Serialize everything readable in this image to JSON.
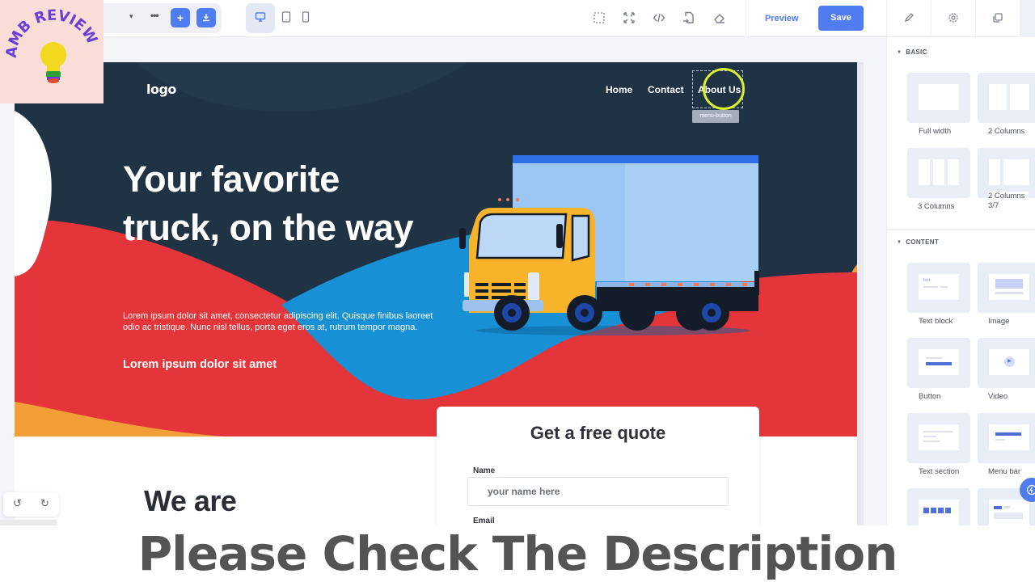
{
  "toolbar": {
    "caret_glyph": "▾",
    "more_glyph": "•••",
    "add_glyph": "+",
    "devices": [
      "desktop",
      "tablet",
      "mobile"
    ],
    "active_device": "desktop",
    "tools": [
      "select-outline-icon",
      "fullscreen-icon",
      "code-icon",
      "import-icon",
      "eraser-icon"
    ],
    "preview_label": "Preview",
    "save_label": "Save",
    "accent_color": "#4f7cf0"
  },
  "right_panel": {
    "tabs": [
      "style-manager",
      "settings",
      "layers"
    ],
    "sections": [
      {
        "title": "BASIC",
        "blocks": [
          {
            "label": "Full width"
          },
          {
            "label": "2 Columns"
          },
          {
            "label": "3 Columns"
          },
          {
            "label": "2 Columns 3/7"
          }
        ]
      },
      {
        "title": "CONTENT",
        "blocks": [
          {
            "label": "Text block"
          },
          {
            "label": "Image"
          },
          {
            "label": "Button"
          },
          {
            "label": "Video"
          },
          {
            "label": "Text section"
          },
          {
            "label": "Menu bar"
          }
        ]
      }
    ],
    "text_block_thumb": "text"
  },
  "canvas": {
    "nav": {
      "logo": "logo",
      "links": [
        "Home",
        "Contact",
        "About Us"
      ],
      "selected_component_tag": "menu-button"
    },
    "hero": {
      "title": "Your favorite truck, on the way",
      "body": "Lorem ipsum dolor sit amet, consectetur adipiscing elit. Quisque finibus laoreet odio ac tristique. Nunc nisl tellus, porta eget eros at, rutrum tempor magna.",
      "subtitle": "Lorem ipsum dolor sit amet",
      "colors": {
        "dark": "#1f3344",
        "red": "#e4353a",
        "blue": "#1890d5",
        "orange": "#f29f38"
      }
    },
    "quote_form": {
      "title": "Get a free quote",
      "name_label": "Name",
      "name_placeholder": "your name here",
      "email_label": "Email"
    },
    "section_heading": "We are"
  },
  "history": {
    "undo_glyph": "↺",
    "redo_glyph": "↻"
  },
  "watermark": {
    "text": "AMB REVIEW"
  },
  "caption": {
    "text": "Please Check The Description"
  }
}
